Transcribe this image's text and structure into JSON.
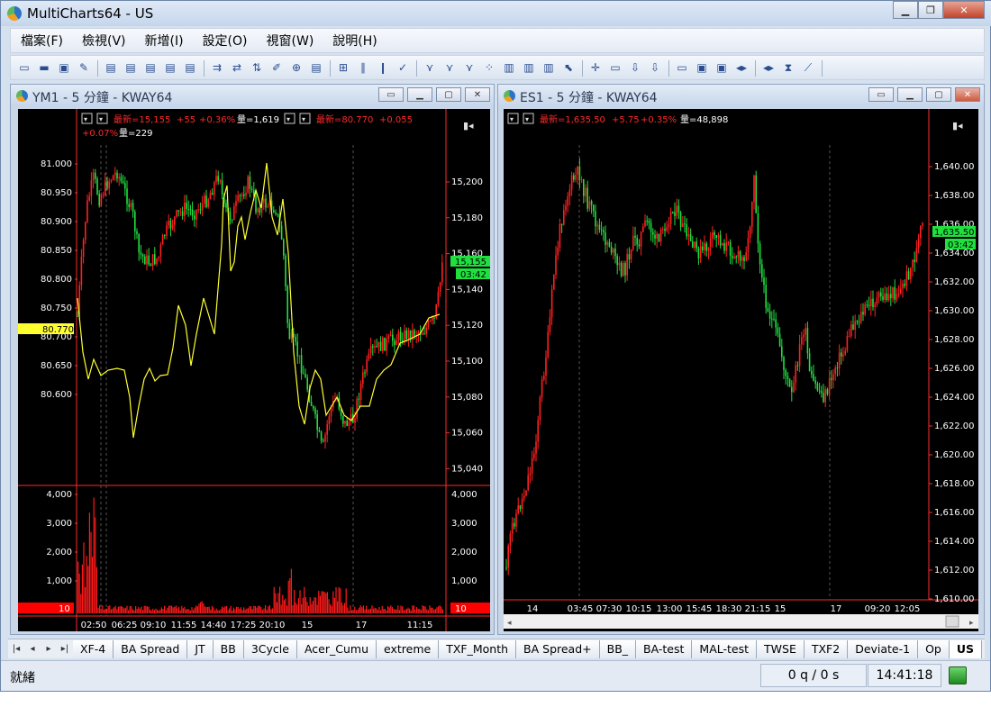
{
  "app": {
    "title": "MultiCharts64 - US"
  },
  "menu": [
    "檔案(F)",
    "檢視(V)",
    "新增(I)",
    "設定(O)",
    "視窗(W)",
    "說明(H)"
  ],
  "chart_left": {
    "title": "YM1 - 5 分鐘 - KWAY64",
    "status_line1": {
      "label": "最新=15,155",
      "change": "+55",
      "pct": "+0.36%",
      "vol": "量=1,619",
      "label2": "最新=80.770",
      "change2": "+0.055"
    },
    "status_line2": {
      "pct": "+0.07%",
      "vol": "量=229"
    },
    "left_axis": [
      "81.000",
      "80.950",
      "80.900",
      "80.850",
      "80.800",
      "80.750",
      "80.700",
      "80.650",
      "80.600"
    ],
    "left_marker": "80.770",
    "right_axis": [
      "15,200",
      "15,180",
      "15,160",
      "15,140",
      "15,120",
      "15,100",
      "15,080",
      "15,060",
      "15,040"
    ],
    "price_marker": "15,155",
    "time_marker": "03:42",
    "volume_axis": [
      "4,000",
      "3,000",
      "2,000",
      "1,000"
    ],
    "volume_marker": "10",
    "x_axis": [
      "02:50",
      "06:25",
      "09:10",
      "11:55",
      "14:40",
      "17:25",
      "20:10",
      "15",
      "17",
      "11:15"
    ]
  },
  "chart_right": {
    "title": "ES1 - 5 分鐘 - KWAY64",
    "status_line1": {
      "label": "最新=1,635.50",
      "change": "+5.75",
      "pct": "+0.35%",
      "vol": "量=48,898"
    },
    "right_axis": [
      "1,640.00",
      "1,638.00",
      "1,636.00",
      "1,634.00",
      "1,632.00",
      "1,630.00",
      "1,628.00",
      "1,626.00",
      "1,624.00",
      "1,622.00",
      "1,620.00",
      "1,618.00",
      "1,616.00",
      "1,614.00",
      "1,612.00",
      "1,610.00"
    ],
    "price_marker": "1,635.50",
    "time_marker": "03:42",
    "x_axis": [
      "14",
      "03:45",
      "07:30",
      "10:15",
      "13:00",
      "15:45",
      "18:30",
      "21:15",
      "15",
      "17",
      "09:20",
      "12:05"
    ]
  },
  "tabs": [
    "XF-4",
    "BA Spread",
    "JT",
    "BB",
    "3Cycle",
    "Acer_Cumu",
    "extreme",
    "TXF_Month",
    "BA Spread+",
    "BB_",
    "BA-test",
    "MAL-test",
    "TWSE",
    "TXF2",
    "Deviate-1",
    "Op",
    "US"
  ],
  "active_tab": "US",
  "status": {
    "text": "就緒",
    "orders": "0 q / 0 s",
    "time": "14:41:18"
  },
  "colors": {
    "up": "#ff2020",
    "down": "#20e040",
    "overlay": "#ffff30",
    "axis": "#ff2a2a"
  }
}
